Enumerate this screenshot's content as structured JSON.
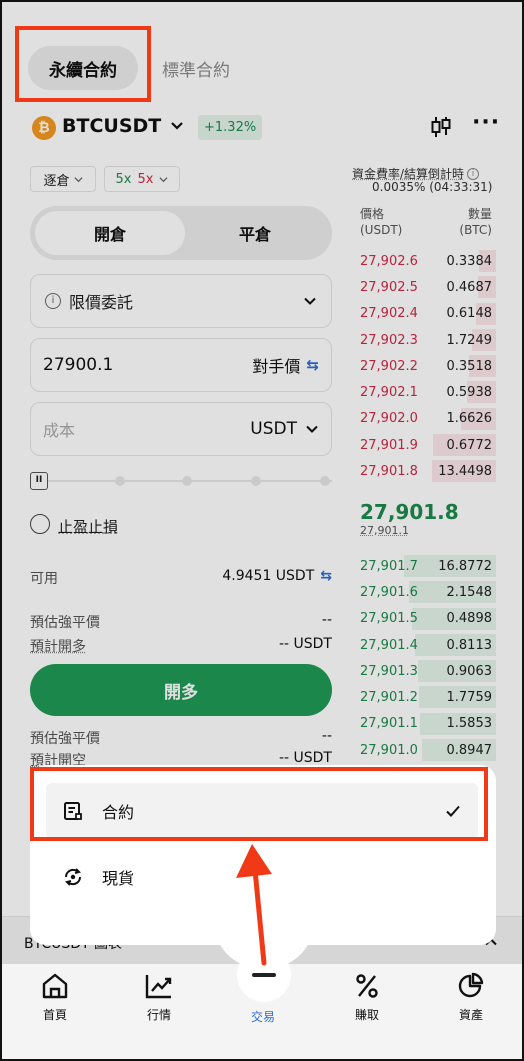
{
  "header": {
    "tab_perpetual": "永續合約",
    "tab_standard": "標準合約",
    "pair": "BTCUSDT",
    "change": "+1.32%",
    "more": "···"
  },
  "margin": {
    "mode": "逐倉",
    "lev_long": "5x",
    "lev_short": "5x"
  },
  "funding": {
    "label": "資金費率/結算倒計時",
    "value": "0.0035% (04:33:31)"
  },
  "orderbook": {
    "price_header": "價格",
    "price_unit": "(USDT)",
    "qty_header": "數量",
    "qty_unit": "(BTC)",
    "asks": [
      {
        "price": "27,902.6",
        "qty": "0.3384",
        "depth": 0.12
      },
      {
        "price": "27,902.5",
        "qty": "0.4687",
        "depth": 0.13
      },
      {
        "price": "27,902.4",
        "qty": "0.6148",
        "depth": 0.14
      },
      {
        "price": "27,902.3",
        "qty": "1.7249",
        "depth": 0.17
      },
      {
        "price": "27,902.2",
        "qty": "0.3518",
        "depth": 0.19
      },
      {
        "price": "27,902.1",
        "qty": "0.5938",
        "depth": 0.21
      },
      {
        "price": "27,902.0",
        "qty": "1.6626",
        "depth": 0.25
      },
      {
        "price": "27,901.9",
        "qty": "0.6772",
        "depth": 0.45
      },
      {
        "price": "27,901.8",
        "qty": "13.4498",
        "depth": 0.46
      }
    ],
    "last_price": "27,901.8",
    "mark_price": "27,901.1",
    "bids": [
      {
        "price": "27,901.7",
        "qty": "16.8772",
        "depth": 0.66
      },
      {
        "price": "27,901.6",
        "qty": "2.1548",
        "depth": 0.62
      },
      {
        "price": "27,901.5",
        "qty": "0.4898",
        "depth": 0.6
      },
      {
        "price": "27,901.4",
        "qty": "0.8113",
        "depth": 0.58
      },
      {
        "price": "27,901.3",
        "qty": "0.9063",
        "depth": 0.56
      },
      {
        "price": "27,901.2",
        "qty": "1.7759",
        "depth": 0.55
      },
      {
        "price": "27,901.1",
        "qty": "1.5853",
        "depth": 0.54
      },
      {
        "price": "27,901.0",
        "qty": "0.8947",
        "depth": 0.53
      }
    ]
  },
  "order_form": {
    "open_tab": "開倉",
    "close_tab": "平倉",
    "order_type": "限價委託",
    "price_value": "27900.1",
    "counterparty_price": "對手價",
    "cost_placeholder": "成本",
    "cost_unit": "USDT",
    "tpsl_label": "止盈止損",
    "available_label": "可用",
    "available_value": "4.9451 USDT",
    "est_liq_label": "預估強平價",
    "est_liq_value": "--",
    "est_long_label": "預計開多",
    "est_long_value": "-- USDT",
    "open_long_button": "開多",
    "est_liq_label_2": "預估強平價",
    "est_liq_value_2": "--",
    "est_short_label": "預計開空",
    "est_short_value": "-- USDT"
  },
  "chart_bar": {
    "label": "BTCUSDT 圖表"
  },
  "sheet": {
    "contract": "合約",
    "spot": "現貨"
  },
  "tabbar": {
    "home": "首頁",
    "market": "行情",
    "trade": "交易",
    "earn": "賺取",
    "assets": "資產"
  }
}
